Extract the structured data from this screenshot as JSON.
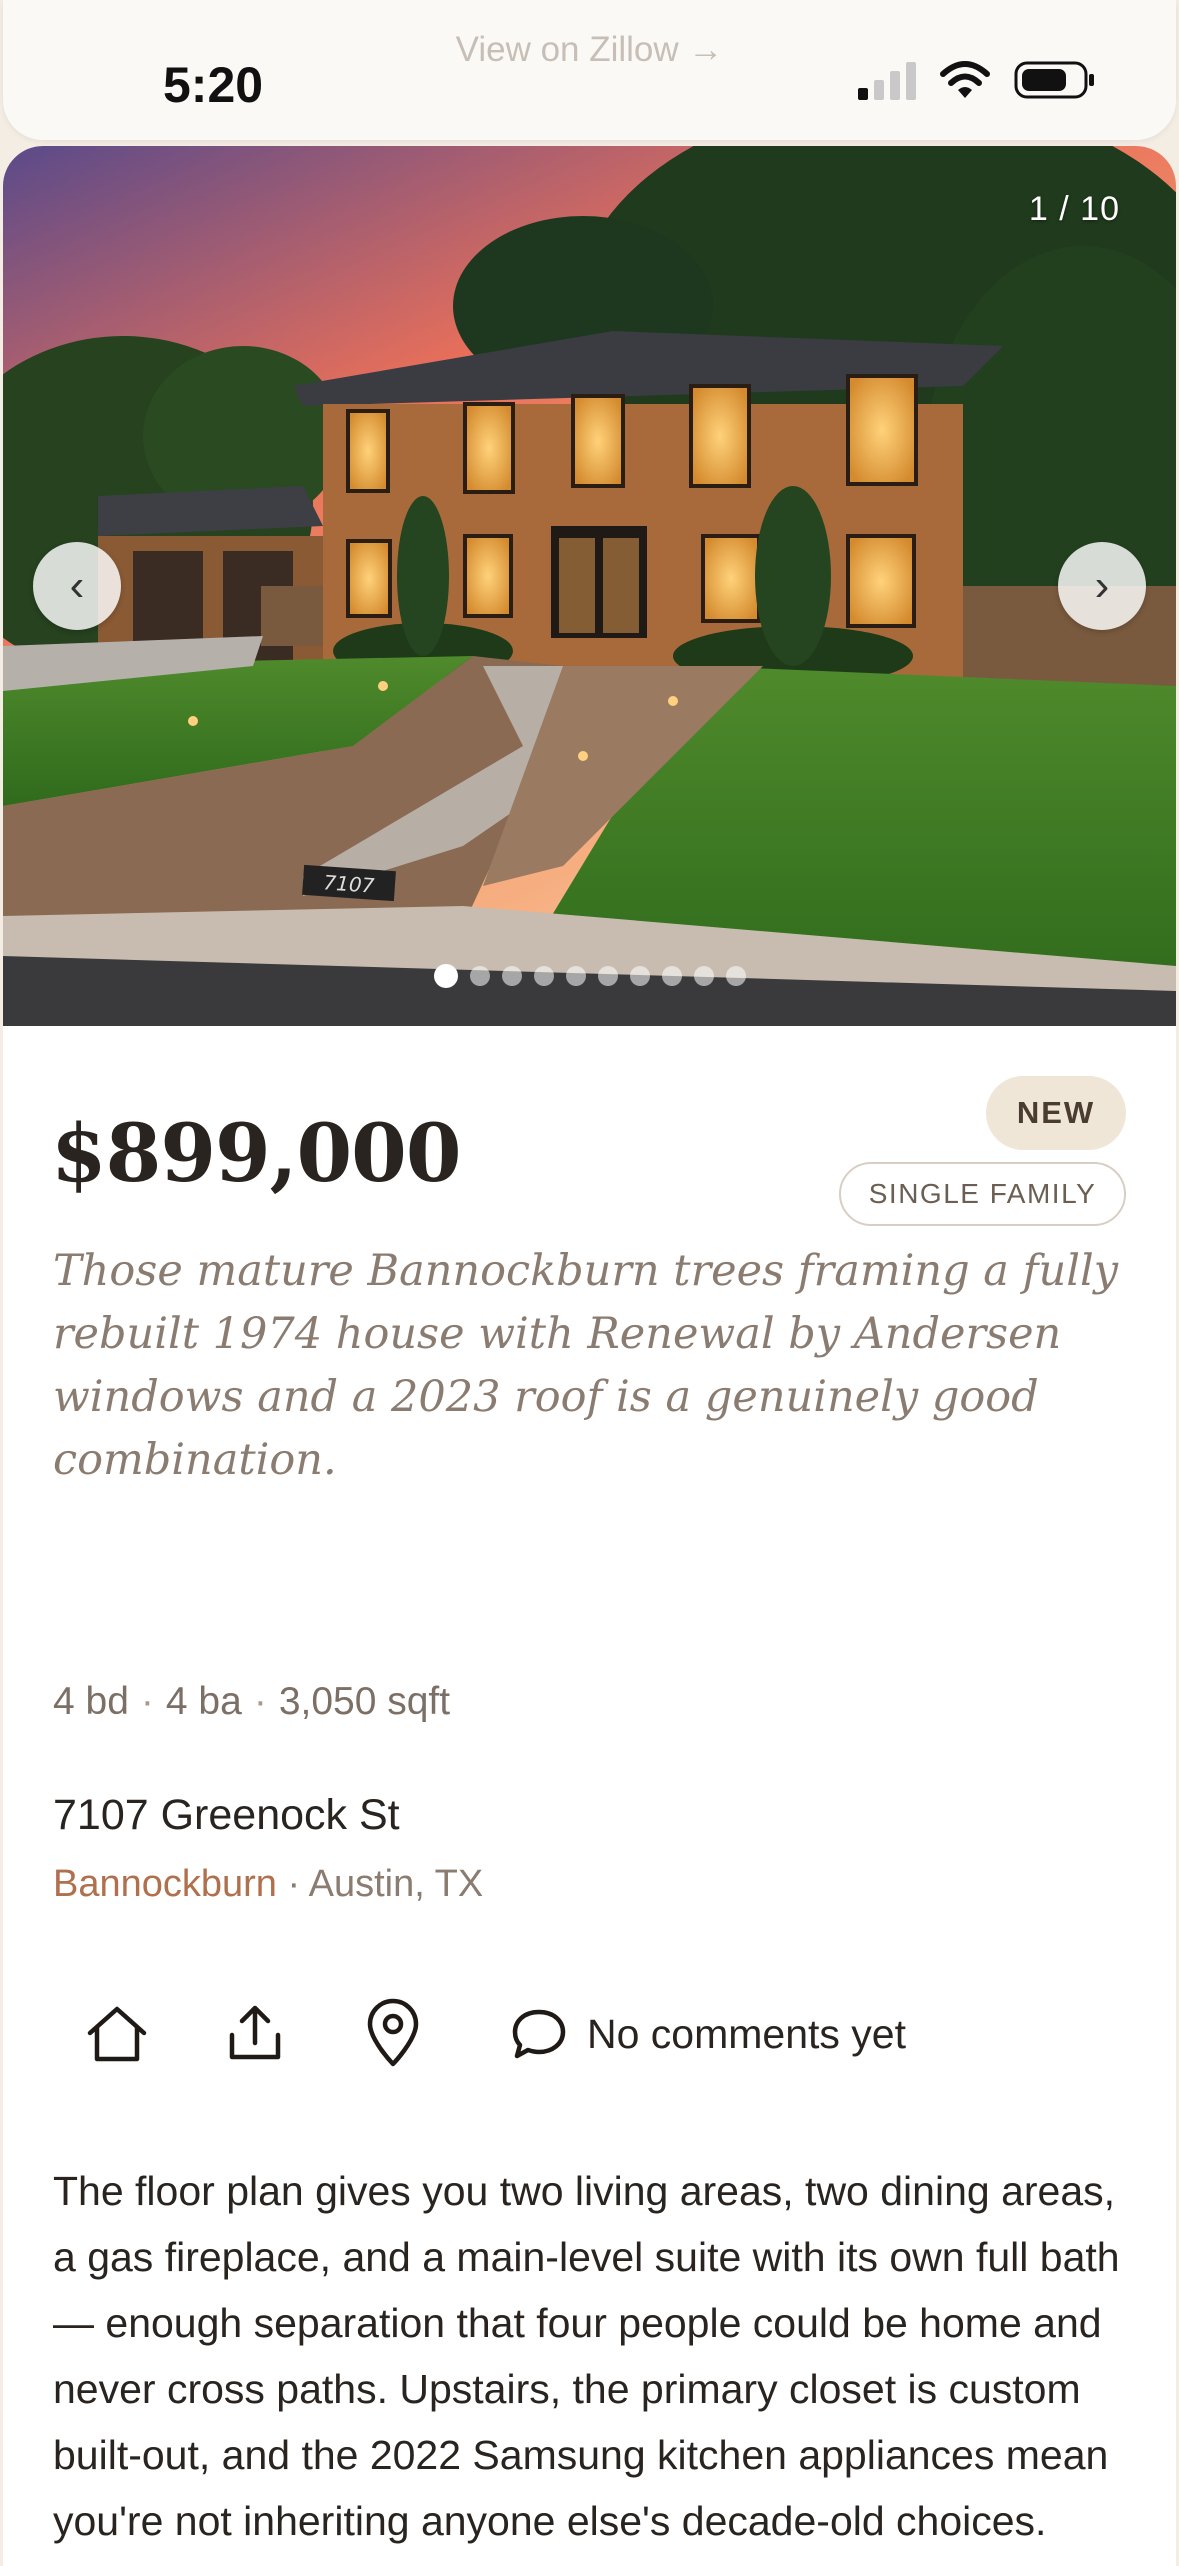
{
  "status_bar": {
    "time": "5:20",
    "link_text": "View on Zillow →",
    "icons": [
      "signal-icon",
      "wifi-icon",
      "battery-icon"
    ]
  },
  "gallery": {
    "counter": "1 / 10",
    "prev_glyph": "‹",
    "next_glyph": "›",
    "total_photos": 10,
    "active_index": 0,
    "address_plaque": "7107"
  },
  "listing": {
    "price": "$899,000",
    "badge_new": "NEW",
    "badge_type": "SINGLE FAMILY",
    "tagline": "Those mature Bannockburn trees framing a fully rebuilt 1974 house with Renewal by Andersen windows and a 2023 roof is a genuinely good combination.",
    "beds": "4 bd",
    "baths": "4 ba",
    "sqft": "3,050 sqft",
    "stats_separator": "·",
    "address": "7107 Greenock St",
    "neighborhood": "Bannockburn",
    "city": "· Austin, TX"
  },
  "actions": {
    "icons": [
      "home-icon",
      "share-icon",
      "map-pin-icon",
      "comment-icon"
    ],
    "comments_label": "No comments yet"
  },
  "description": "The floor plan gives you two living areas, two dining areas, a gas fireplace, and a main-level suite with its own full bath — enough separation that four people could be home and never cross paths. Upstairs, the primary closet is custom built-out, and the 2022 Samsung kitchen appliances mean you're not inheriting anyone else's decade-old choices. Mopac is two minutes away and HEB, Whole Foods, and",
  "colors": {
    "background": "#f3ede4",
    "card": "#ffffff",
    "accent_neighborhood": "#b0704e",
    "badge_new_bg": "#efe6d8",
    "text_primary": "#2a2420",
    "text_muted": "#8a7c70"
  }
}
